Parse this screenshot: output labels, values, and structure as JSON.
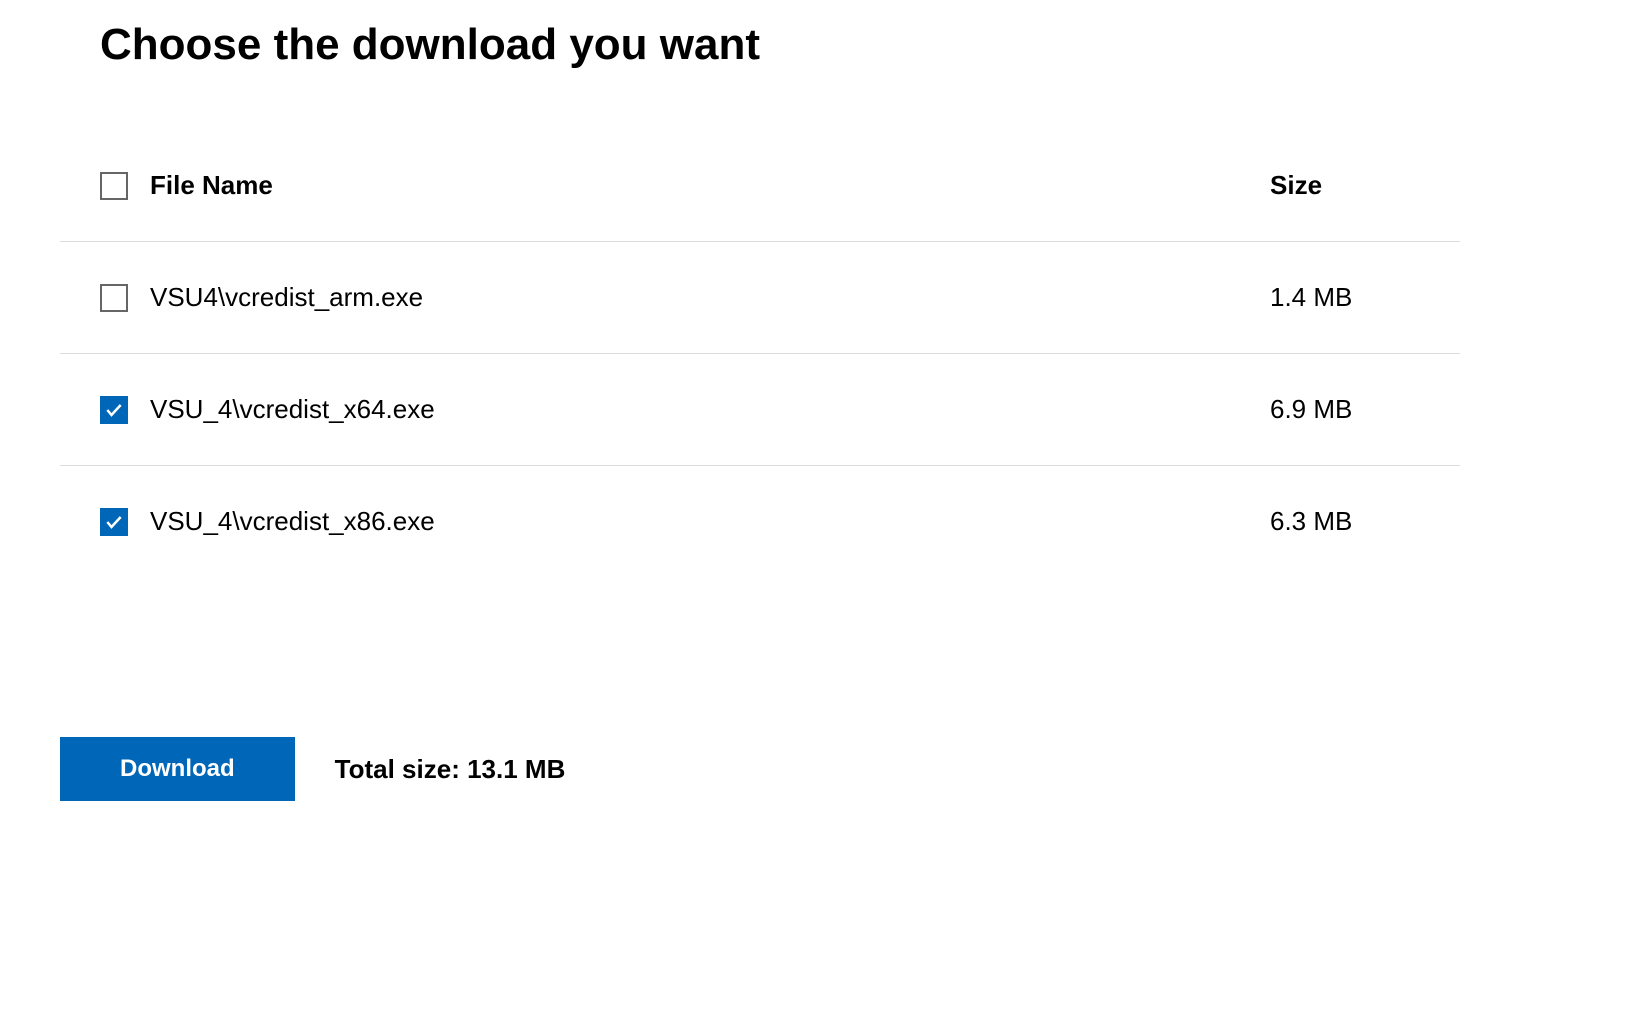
{
  "title": "Choose the download you want",
  "columns": {
    "name": "File Name",
    "size": "Size"
  },
  "files": [
    {
      "name": "VSU4\\vcredist_arm.exe",
      "size": "1.4 MB",
      "checked": false
    },
    {
      "name": "VSU_4\\vcredist_x64.exe",
      "size": "6.9 MB",
      "checked": true
    },
    {
      "name": "VSU_4\\vcredist_x86.exe",
      "size": "6.3 MB",
      "checked": true
    }
  ],
  "footer": {
    "download_label": "Download",
    "total_size_label": "Total size: 13.1 MB"
  }
}
